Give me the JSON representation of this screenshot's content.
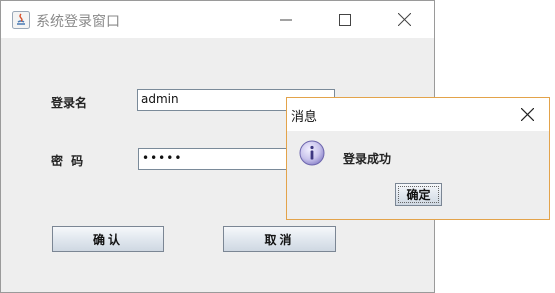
{
  "window": {
    "title": "系统登录窗口"
  },
  "form": {
    "username_label": "登录名",
    "username_value": "admin",
    "password_label": "密 码",
    "password_value": "•••••",
    "ok_button": "确认",
    "cancel_button": "取消"
  },
  "dialog": {
    "title": "消息",
    "message": "登录成功",
    "ok_button": "确定"
  },
  "colors": {
    "dialog_border": "#e3a34a",
    "info_icon": "#8a82c9"
  }
}
